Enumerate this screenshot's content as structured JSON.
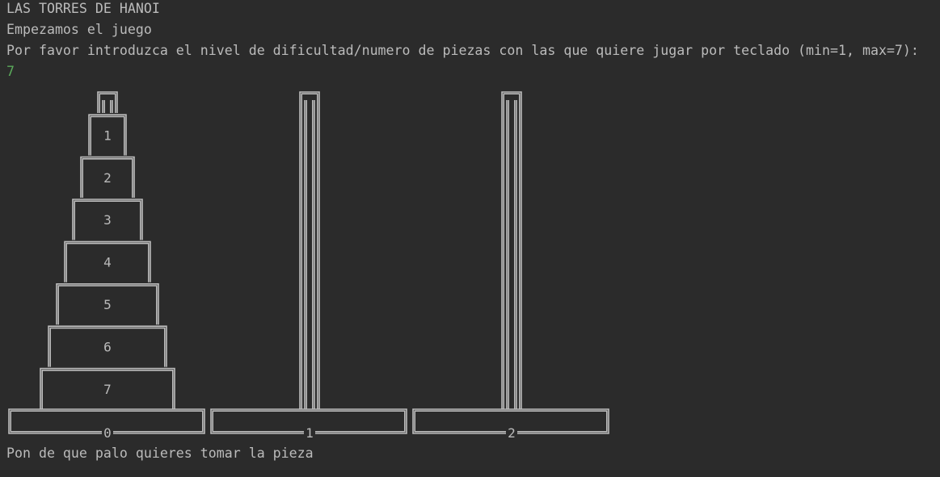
{
  "console": {
    "lines": [
      "LAS TORRES DE HANOI",
      "Empezamos el juego",
      "Por favor introduzca el nivel de dificultad/numero de piezas con las que quiere jugar por teclado (min=1, max=7):",
      "7"
    ],
    "prompt": "Pon de que palo quieres tomar la pieza"
  },
  "game": {
    "num_pieces": 7,
    "pegs": [
      {
        "label": "0",
        "pieces": [
          1,
          2,
          3,
          4,
          5,
          6,
          7
        ]
      },
      {
        "label": "1",
        "pieces": []
      },
      {
        "label": "2",
        "pieces": []
      }
    ]
  },
  "colors": {
    "background": "#2b2b2b",
    "text": "#bbbbbb",
    "input": "#5aa95a",
    "drawing": "#bdbdbd"
  }
}
